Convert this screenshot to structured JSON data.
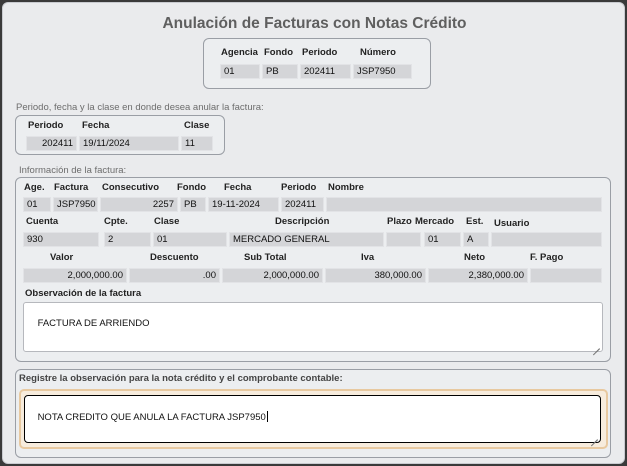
{
  "title": "Anulación de Facturas con Notas Crédito",
  "doc": {
    "headers": [
      "Agencia",
      "Fondo",
      "Periodo",
      "Número"
    ],
    "values": [
      "01",
      "PB",
      "202411",
      "JSP7950"
    ]
  },
  "annul": {
    "section_label": "Periodo, fecha y la clase en donde desea anular la factura:",
    "headers": [
      "Periodo",
      "Fecha",
      "Clase"
    ],
    "values": [
      "202411",
      "19/11/2024",
      "11"
    ]
  },
  "invoice": {
    "section_label": "Información de la factura:",
    "row1_headers": [
      "Age.",
      "Factura",
      "Consecutivo",
      "Fondo",
      "Fecha",
      "Periodo",
      "Nombre"
    ],
    "row1_values": [
      "01",
      "JSP7950",
      "2257",
      "PB",
      "19-11-2024",
      "202411",
      ""
    ],
    "row2_headers": [
      "Cuenta",
      "Cpte.",
      "Clase",
      "Descripción",
      "Plazo",
      "Mercado",
      "Est.",
      "Usuario"
    ],
    "row2_values": [
      "930",
      "2",
      "01",
      "MERCADO GENERAL",
      "",
      "01",
      "A",
      ""
    ],
    "row3_headers": [
      "Valor",
      "Descuento",
      "Sub Total",
      "Iva",
      "Neto",
      "F. Pago"
    ],
    "row3_values": [
      "2,000,000.00",
      ".00",
      "2,000,000.00",
      "380,000.00",
      "2,380,000.00",
      ""
    ],
    "obs_label": "Observación de la factura",
    "obs_value": "FACTURA DE ARRIENDO"
  },
  "note": {
    "label": "Registre la observación para la nota crédito y el comprobante contable:",
    "value": "NOTA CREDITO QUE ANULA LA FACTURA JSP7950"
  },
  "colors": {
    "focus_border": "#e8c9a0",
    "box_border": "#9a9ea5",
    "field_bg": "#d4d5d8"
  }
}
